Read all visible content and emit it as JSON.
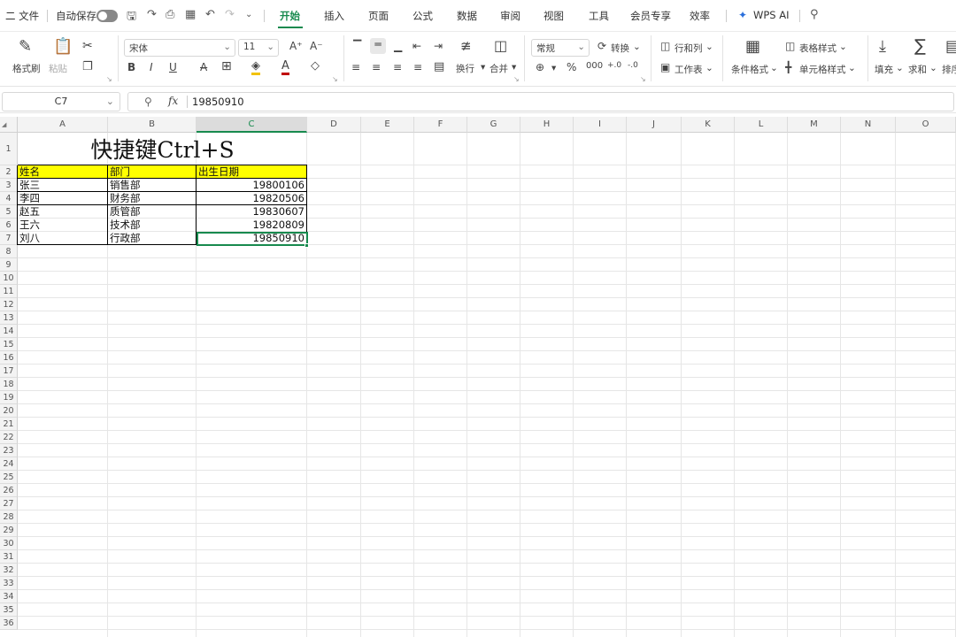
{
  "menubar": {
    "file": "二 文件",
    "autosave": "自动保存",
    "tabs": [
      "开始",
      "插入",
      "页面",
      "公式",
      "数据",
      "审阅",
      "视图",
      "工具",
      "会员专享",
      "效率"
    ],
    "wps_ai": "WPS AI"
  },
  "ribbon": {
    "format_painter": "格式刷",
    "paste": "粘贴",
    "font_name": "宋体",
    "font_size": "11",
    "wrap": "换行",
    "merge": "合并",
    "number_format": "常规",
    "convert": "转换",
    "row_col": "行和列",
    "worksheet": "工作表",
    "conditional_format": "条件格式",
    "table_style": "表格样式",
    "cell_style": "单元格样式",
    "fill": "填充",
    "sum": "求和",
    "sort_filter": "排序"
  },
  "formula_bar": {
    "cell_ref": "C7",
    "fx": "fx",
    "value": "19850910"
  },
  "sheet": {
    "columns": [
      "A",
      "B",
      "C",
      "D",
      "E",
      "F",
      "G",
      "H",
      "I",
      "J",
      "K",
      "L",
      "M",
      "N",
      "O"
    ],
    "selected_column": "C",
    "rows": [
      "1",
      "2",
      "3",
      "4",
      "5",
      "6",
      "7",
      "8",
      "9",
      "10",
      "11",
      "12",
      "13",
      "14",
      "15",
      "16",
      "17",
      "18",
      "19",
      "20",
      "21",
      "22",
      "23",
      "24",
      "25",
      "26",
      "27",
      "28",
      "29",
      "30",
      "31",
      "32",
      "33",
      "34",
      "35",
      "36"
    ],
    "title": "快捷键Ctrl+S",
    "header": [
      "姓名",
      "部门",
      "出生日期"
    ],
    "data": [
      [
        "张三",
        "销售部",
        "19800106"
      ],
      [
        "李四",
        "财务部",
        "19820506"
      ],
      [
        "赵五",
        "质管部",
        "19830607"
      ],
      [
        "王六",
        "技术部",
        "19820809"
      ],
      [
        "刘八",
        "行政部",
        "19850910"
      ]
    ],
    "header_fill": "#ffff00",
    "selection_color": "#178a4e"
  }
}
